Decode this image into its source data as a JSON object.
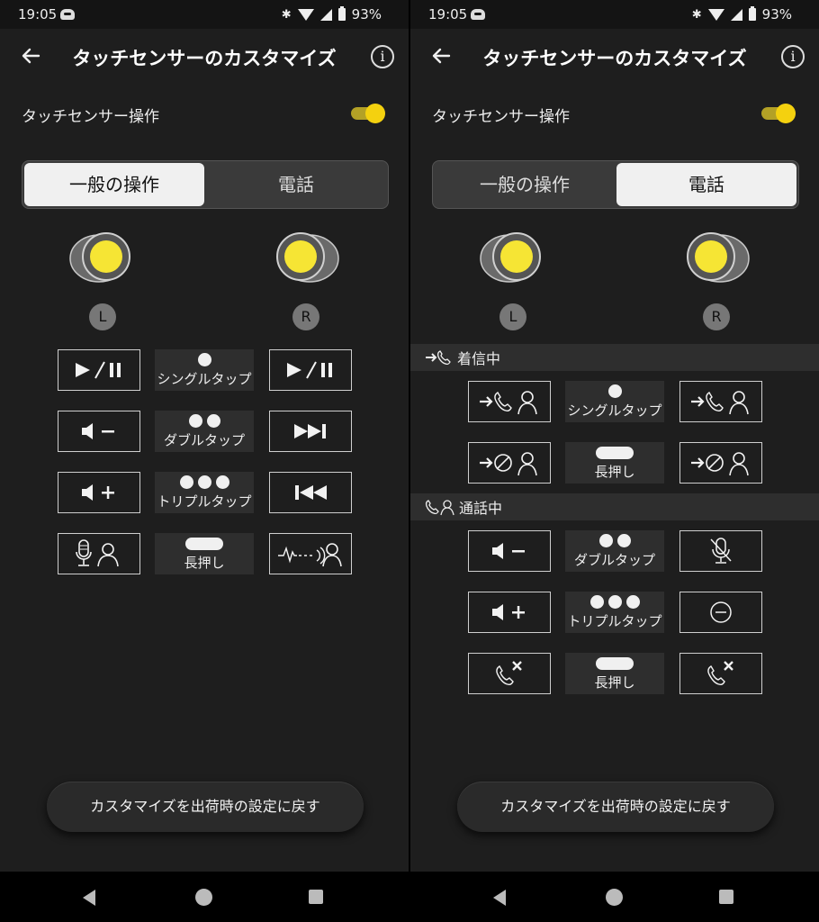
{
  "status": {
    "time": "19:05",
    "battery": "93%",
    "icons": [
      "notification-app-icon",
      "bluetooth-icon",
      "wifi-icon",
      "signal-icon",
      "battery-icon"
    ]
  },
  "header": {
    "title": "タッチセンサーのカスタマイズ",
    "info": "i"
  },
  "toggle": {
    "label": "タッチセンサー操作",
    "on": true
  },
  "tabs": [
    "一般の操作",
    "電話"
  ],
  "earbuds": {
    "left": "L",
    "right": "R"
  },
  "colors": {
    "accent": "#f4d10f",
    "background": "#1e1e1e",
    "active_tab": "#f0f0f0"
  },
  "left_screen": {
    "active_tab": 0,
    "rows": [
      {
        "left": "play-pause-icon",
        "gesture": "シングルタップ",
        "right": "play-pause-icon"
      },
      {
        "left": "volume-down-icon",
        "gesture": "ダブルタップ",
        "right": "next-track-icon"
      },
      {
        "left": "volume-up-icon",
        "gesture": "トリプルタップ",
        "right": "previous-track-icon"
      },
      {
        "left": "voice-assistant-icon",
        "gesture": "長押し",
        "right": "ambient-sound-icon"
      }
    ]
  },
  "right_screen": {
    "active_tab": 1,
    "incoming": {
      "header": "着信中",
      "rows": [
        {
          "left": "answer-call-icon",
          "gesture": "シングルタップ",
          "right": "answer-call-icon"
        },
        {
          "left": "reject-call-icon",
          "gesture": "長押し",
          "right": "reject-call-icon"
        }
      ]
    },
    "in_call": {
      "header": "通話中",
      "rows": [
        {
          "left": "volume-down-icon",
          "gesture": "ダブルタップ",
          "right": "mute-mic-icon"
        },
        {
          "left": "volume-up-icon",
          "gesture": "トリプルタップ",
          "right": "no-action-icon"
        },
        {
          "left": "end-call-icon",
          "gesture": "長押し",
          "right": "end-call-icon"
        }
      ]
    }
  },
  "reset_button": "カスタマイズを出荷時の設定に戻す"
}
